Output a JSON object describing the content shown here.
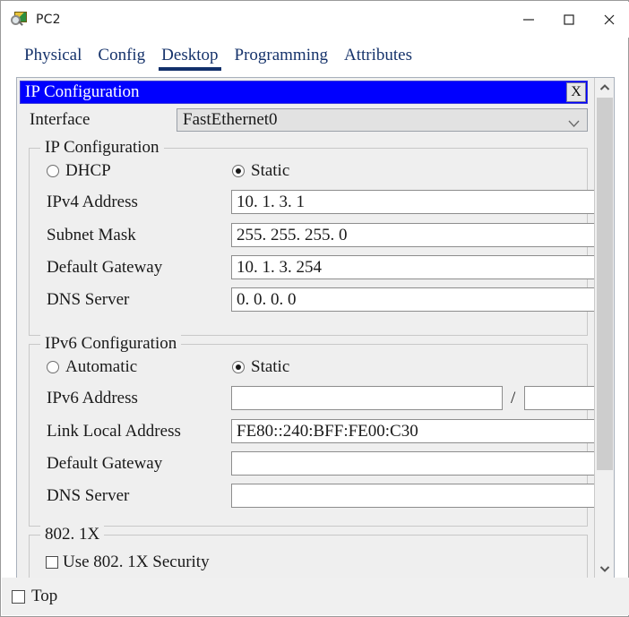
{
  "window": {
    "title": "PC2",
    "icon": "pc-magnifier-icon",
    "controls": {
      "minimize": "minimize-icon",
      "maximize": "maximize-icon",
      "close": "close-icon"
    }
  },
  "tabs": [
    {
      "label": "Physical",
      "active": false
    },
    {
      "label": "Config",
      "active": false
    },
    {
      "label": "Desktop",
      "active": true
    },
    {
      "label": "Programming",
      "active": false
    },
    {
      "label": "Attributes",
      "active": false
    }
  ],
  "panel": {
    "title": "IP Configuration",
    "close_label": "X",
    "title_bg": "#0000ff",
    "title_fg": "#ffffff"
  },
  "interface": {
    "label": "Interface",
    "value": "FastEthernet0",
    "arrow_icon": "chevron-down-icon"
  },
  "ipv4": {
    "group_label": "IP Configuration",
    "mode": {
      "dhcp_label": "DHCP",
      "static_label": "Static",
      "selected": "Static"
    },
    "fields": [
      {
        "label": "IPv4 Address",
        "value": "10. 1. 3. 1"
      },
      {
        "label": "Subnet Mask",
        "value": "255. 255. 255. 0"
      },
      {
        "label": "Default Gateway",
        "value": "10. 1. 3. 254"
      },
      {
        "label": "DNS Server",
        "value": "0. 0. 0. 0"
      }
    ]
  },
  "ipv6": {
    "group_label": "IPv6 Configuration",
    "mode": {
      "automatic_label": "Automatic",
      "static_label": "Static",
      "selected": "Static"
    },
    "address": {
      "label": "IPv6 Address",
      "value": "",
      "separator": "/",
      "prefix_value": ""
    },
    "fields": [
      {
        "label": "Link Local Address",
        "value": "FE80::240:BFF:FE00:C30"
      },
      {
        "label": "Default Gateway",
        "value": ""
      },
      {
        "label": "DNS Server",
        "value": ""
      }
    ]
  },
  "dot1x": {
    "group_label": "802. 1X",
    "checkbox_label": "Use 802. 1X Security",
    "checked": false
  },
  "bottom": {
    "top_label": "Top",
    "checked": false
  },
  "scrollbar": {
    "up_icon": "chevron-up-icon",
    "down_icon": "chevron-down-icon",
    "thumb": "scroll-thumb"
  }
}
